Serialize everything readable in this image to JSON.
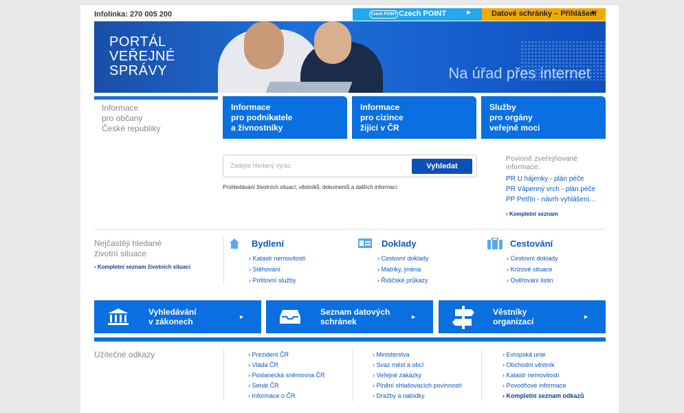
{
  "topbar": {
    "infolinka": "Infolinka: 270 005 200",
    "czech_point_badge": "Czech POINT",
    "czech_point": "Czech POINT",
    "datove_schranky": "Datové schránky – Přihlášení",
    "arrow": "►"
  },
  "banner": {
    "logo_lines": [
      "PORTÁL",
      "VEŘEJNÉ",
      "SPRÁVY"
    ],
    "slogan": "Na úřad přes internet"
  },
  "tabs": [
    {
      "lines": [
        "Informace",
        "pro občany",
        "České republiky"
      ],
      "active": true
    },
    {
      "lines": [
        "Informace",
        "pro podnikatele",
        "a živnostníky"
      ]
    },
    {
      "lines": [
        "Informace",
        "pro cizince",
        "žijící v ČR"
      ]
    },
    {
      "lines": [
        "Služby",
        "pro orgány",
        "veřejné moci"
      ]
    }
  ],
  "search": {
    "placeholder": "Zadejte hledaný výraz",
    "button": "Vyhledat",
    "note": "Prohledávání životních situací, věstníků, dokumentů a dalších informací"
  },
  "povinne": {
    "title_lines": [
      "Povinně zveřejňované",
      "informace:"
    ],
    "items": [
      "PR U hájenky - plán péče",
      "PR Vápenný vrch - plán péče",
      "PP Petřín - návrh vyhlášení..."
    ],
    "more": "› Kompletní seznam"
  },
  "situations": {
    "title_lines": [
      "Nejčastěji hledané",
      "životní situace"
    ],
    "more": "› Kompletní seznam životních situací",
    "categories": [
      {
        "title": "Bydlení",
        "icon": "house-icon",
        "links": [
          "› Katastr nemovitostí",
          "› Stěhování",
          "› Poštovní služby"
        ]
      },
      {
        "title": "Doklady",
        "icon": "id-card-icon",
        "links": [
          "› Cestovní doklady",
          "› Matriky, jména",
          "› Řidičské průkazy"
        ]
      },
      {
        "title": "Cestování",
        "icon": "suitcase-icon",
        "links": [
          "› Cestovní doklady",
          "› Krizové situace",
          "› Ověřování listin"
        ]
      }
    ]
  },
  "big_buttons": [
    {
      "lines": [
        "Vyhledávání",
        "v zákonech"
      ],
      "icon": "institution-icon",
      "arrow": "►"
    },
    {
      "lines": [
        "Seznam datových",
        "schránek"
      ],
      "icon": "inbox-icon",
      "arrow": "►"
    },
    {
      "lines": [
        "Věstníky",
        "organizací"
      ],
      "icon": "signpost-icon",
      "arrow": "►"
    }
  ],
  "useful": {
    "title": "Užitečné odkazy",
    "columns": [
      [
        "› Prezident ČR",
        "› Vláda ČR",
        "› Poslanecká sněmovna ČR",
        "› Senát ČR",
        "› Informace o ČR"
      ],
      [
        "› Ministerstva",
        "› Svaz měst a obcí",
        "› Veřejné zakázky",
        "› Plnění ohlašovacích povinností",
        "› Dražby a nabídky"
      ],
      [
        "› Evropská unie",
        "› Obchodní věstník",
        "› Katastr nemovitostí",
        "› Povodňové informace",
        "› Kompletní seznam odkazů"
      ]
    ]
  },
  "colors": {
    "primary": "#0a6fe0",
    "accent_orange": "#f5a800",
    "czech_point": "#22a7f0",
    "link": "#0b57c4"
  }
}
